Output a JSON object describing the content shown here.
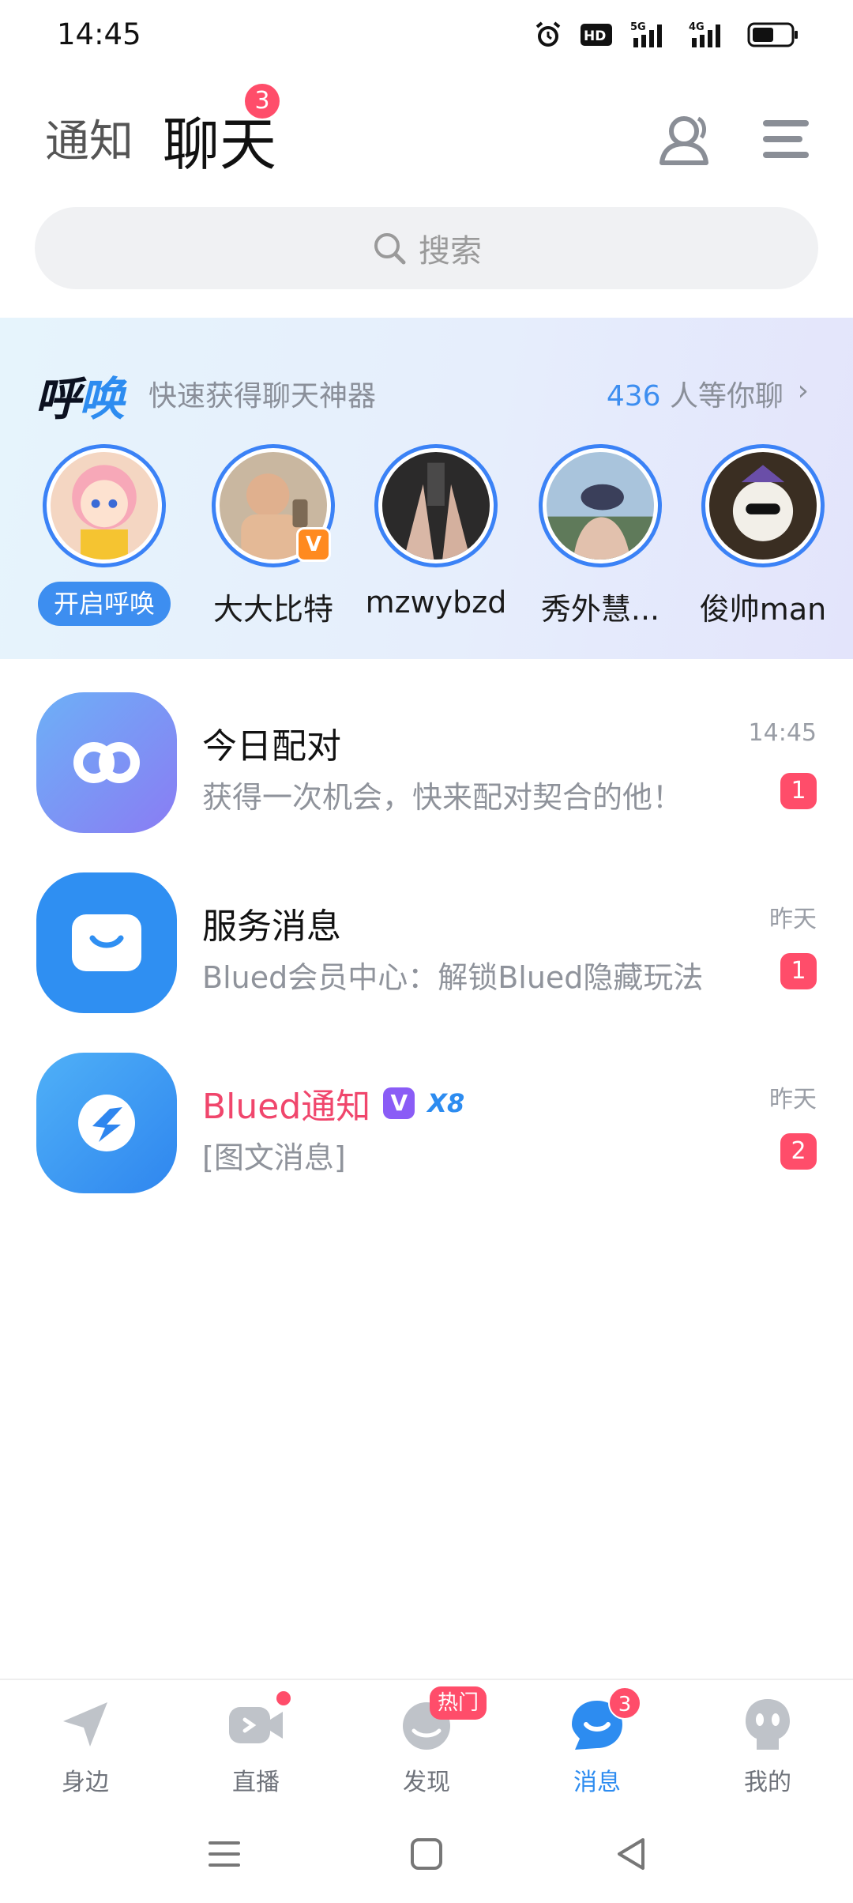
{
  "status_bar": {
    "time": "14:45",
    "hd_label": "HD",
    "net1": "5G",
    "net2": "4G"
  },
  "header": {
    "tab_notice": "通知",
    "tab_chat": "聊天",
    "chat_badge": "3",
    "contacts_icon": "contacts-icon",
    "menu_icon": "menu-icon"
  },
  "search": {
    "placeholder": "搜索",
    "icon": "search-icon"
  },
  "call_banner": {
    "logo_part1": "呼",
    "logo_part2": "唤",
    "subtitle": "快速获得聊天神器",
    "count_number": "436",
    "count_suffix": "人等你聊",
    "chevron": "›",
    "open_call_label": "开启呼唤",
    "users": [
      {
        "name": "大大比特",
        "verified_badge": "V"
      },
      {
        "name": "mzwybzd"
      },
      {
        "name": "秀外慧..."
      },
      {
        "name": "俊帅man"
      }
    ]
  },
  "messages": [
    {
      "title": "今日配对",
      "preview": "获得一次机会，快来配对契合的他！",
      "time": "14:45",
      "count": "1",
      "icon": "match-icon",
      "icon_color": "#7b8cf5"
    },
    {
      "title": "服务消息",
      "preview": "Blued会员中心：解锁Blued隐藏玩法",
      "time": "昨天",
      "count": "1",
      "icon": "service-icon",
      "icon_color": "#2f8ff2"
    },
    {
      "title": "Blued通知",
      "preview": "[图文消息]",
      "time": "昨天",
      "count": "2",
      "icon": "blued-notice-icon",
      "icon_color": "#3a97f2",
      "title_color": "#f0466c",
      "v_badge": "V",
      "level_badge": "X8"
    }
  ],
  "bottom_nav": {
    "items": [
      {
        "label": "身边",
        "icon": "nearby-icon"
      },
      {
        "label": "直播",
        "icon": "live-icon"
      },
      {
        "label": "发现",
        "icon": "discover-icon",
        "hot": "热门"
      },
      {
        "label": "消息",
        "icon": "message-icon",
        "badge": "3"
      },
      {
        "label": "我的",
        "icon": "profile-icon"
      }
    ],
    "active_color": "#2d8cf0"
  },
  "system_nav": {
    "icons": [
      "menu-lines-icon",
      "home-square-icon",
      "back-triangle-icon"
    ]
  }
}
